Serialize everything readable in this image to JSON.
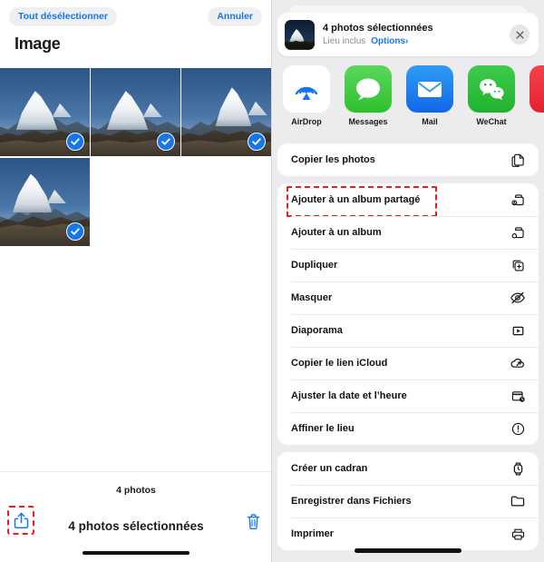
{
  "left": {
    "deselect_all_label": "Tout désélectionner",
    "cancel_label": "Annuler",
    "title": "Image",
    "photo_count_label": "4 photos",
    "selected_label": "4 photos sélectionnées",
    "share_icon": "share-icon",
    "trash_icon": "trash-icon",
    "photos": [
      {
        "alt": "mountain-photo-1",
        "selected": true
      },
      {
        "alt": "mountain-photo-2",
        "selected": true
      },
      {
        "alt": "mountain-photo-3",
        "selected": true
      },
      {
        "alt": "mountain-photo-4",
        "selected": true
      }
    ]
  },
  "share_sheet": {
    "header": {
      "title": "4 photos sélectionnées",
      "subtitle": "Lieu inclus",
      "options_label": "Options",
      "options_chevron": "›",
      "close_icon": "close-icon",
      "thumbnail": "photo-thumbnail"
    },
    "apps": [
      {
        "label": "AirDrop",
        "icon": "airdrop-icon",
        "color": "#1477ec"
      },
      {
        "label": "Messages",
        "icon": "messages-icon",
        "color": "#35c759"
      },
      {
        "label": "Mail",
        "icon": "mail-icon",
        "color": "#1d7ef0"
      },
      {
        "label": "WeChat",
        "icon": "wechat-icon",
        "color": "#2dc244"
      },
      {
        "label": "",
        "icon": "partial-app-icon",
        "color": "#ea2633"
      }
    ],
    "groups": [
      {
        "items": [
          {
            "label": "Copier les photos",
            "icon": "copy-photos-icon",
            "highlighted": false
          }
        ]
      },
      {
        "items": [
          {
            "label": "Ajouter à un album partagé",
            "icon": "shared-album-icon",
            "highlighted": true
          },
          {
            "label": "Ajouter à un album",
            "icon": "album-icon",
            "highlighted": false
          },
          {
            "label": "Dupliquer",
            "icon": "duplicate-icon",
            "highlighted": false
          },
          {
            "label": "Masquer",
            "icon": "hide-eye-icon",
            "highlighted": false
          },
          {
            "label": "Diaporama",
            "icon": "slideshow-icon",
            "highlighted": false
          },
          {
            "label": "Copier le lien iCloud",
            "icon": "icloud-link-icon",
            "highlighted": false
          },
          {
            "label": "Ajuster la date et l’heure",
            "icon": "adjust-date-icon",
            "highlighted": false
          },
          {
            "label": "Affiner le lieu",
            "icon": "refine-location-icon",
            "highlighted": false
          }
        ]
      },
      {
        "items": [
          {
            "label": "Créer un cadran",
            "icon": "watch-face-icon",
            "highlighted": false
          },
          {
            "label": "Enregistrer dans Fichiers",
            "icon": "folder-icon",
            "highlighted": false
          },
          {
            "label": "Imprimer",
            "icon": "printer-icon",
            "highlighted": false
          }
        ]
      }
    ]
  },
  "colors": {
    "accent_blue": "#1477ec",
    "highlight_red": "#f01b1b",
    "sheet_bg": "#ececee",
    "row_bg": "#ffffff"
  }
}
